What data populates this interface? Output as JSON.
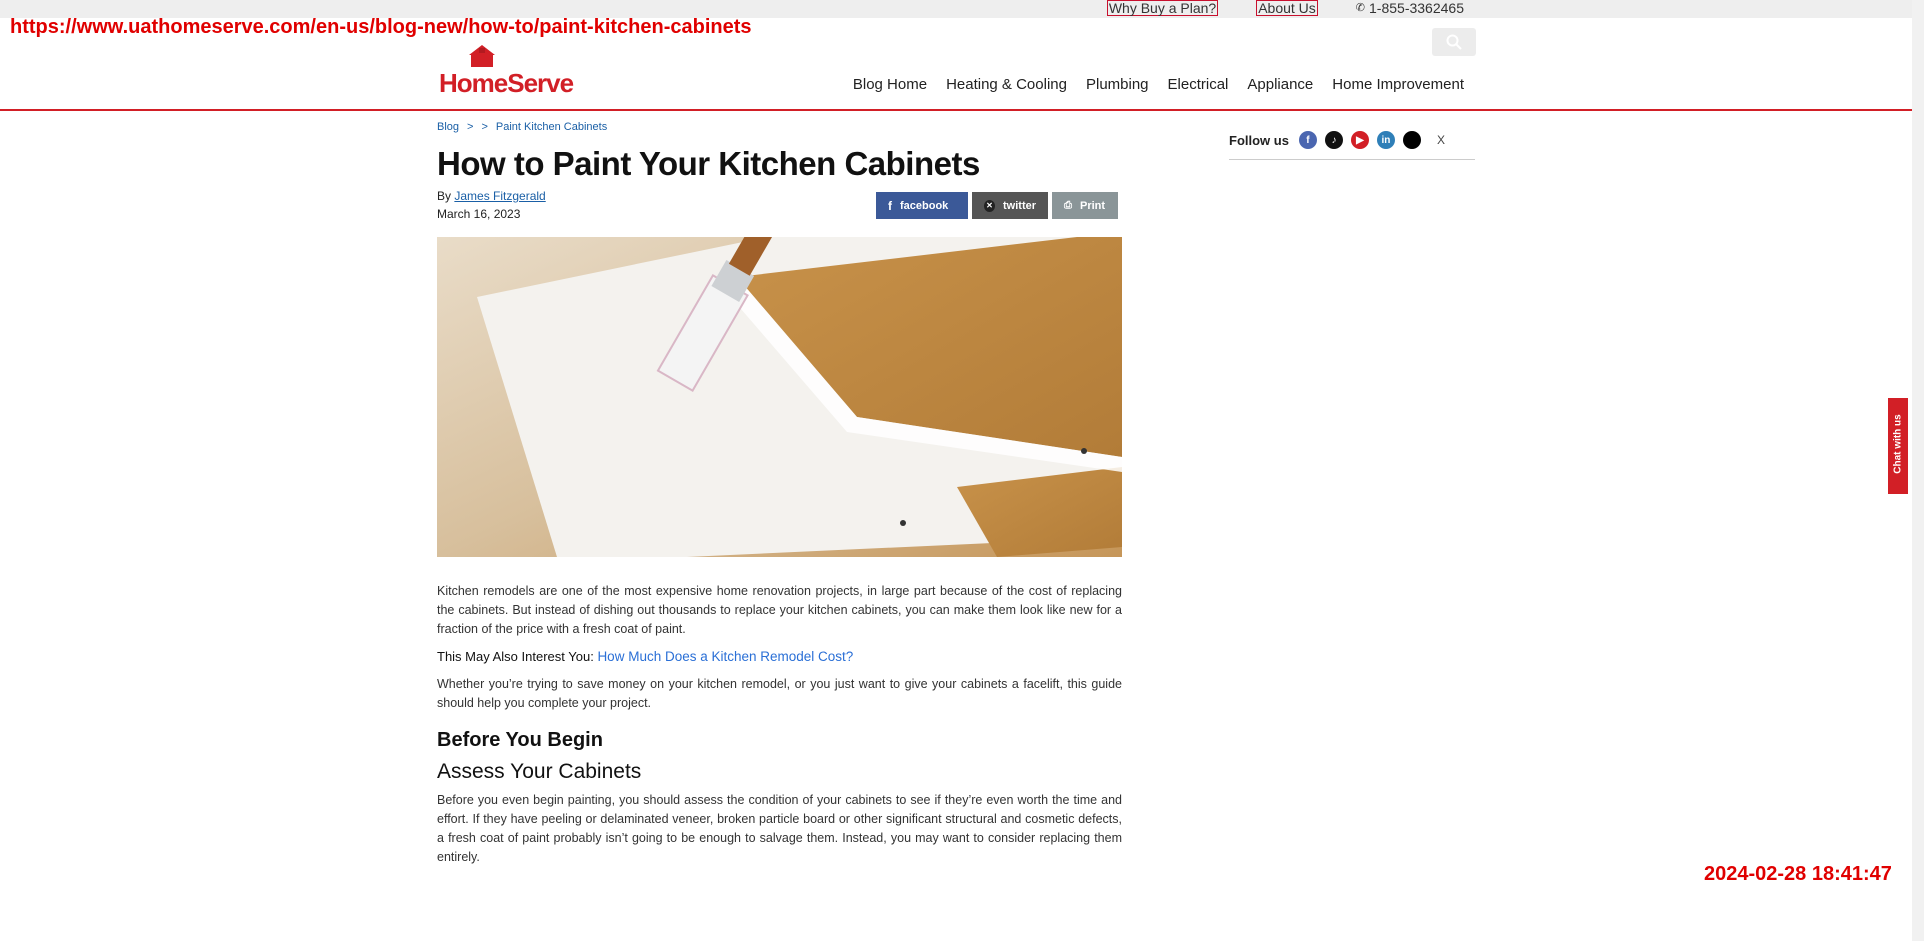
{
  "overlay": {
    "url": "https://www.uathomeserve.com/en-us/blog-new/how-to/paint-kitchen-cabinets",
    "timestamp": "2024-02-28 18:41:47"
  },
  "utility": {
    "why_buy": "Why Buy a Plan?",
    "about": "About Us",
    "phone": "1-855-3362465"
  },
  "header": {
    "logo_text": "HomeServe",
    "nav": [
      "Blog Home",
      "Heating & Cooling",
      "Plumbing",
      "Electrical",
      "Appliance",
      "Home Improvement"
    ]
  },
  "breadcrumb": {
    "blog": "Blog",
    "sep1": ">",
    "sep2": ">",
    "current": "Paint Kitchen Cabinets"
  },
  "article": {
    "title": "How to Paint Your Kitchen Cabinets",
    "by": "By",
    "author": "James Fitzgerald",
    "date": "March 16, 2023",
    "share": {
      "facebook": "facebook",
      "twitter": "twitter",
      "print": "Print"
    },
    "intro": "Kitchen remodels are one of the most expensive home renovation projects, in large part because of the cost of replacing the cabinets. But instead of dishing out thousands to replace your kitchen cabinets, you can make them look like new for a fraction of the price with a fresh coat of paint.",
    "interest_label": "This May Also Interest You:",
    "interest_link": "How Much Does a Kitchen Remodel Cost?",
    "para2": "Whether you’re trying to save money on your kitchen remodel, or you just want to give your cabinets a facelift, this guide should help you complete your project.",
    "h2": "Before You Begin",
    "h3": "Assess Your Cabinets",
    "para3": "Before you even begin painting, you should assess the condition of your cabinets to see if they’re even worth the time and effort. If they have peeling or delaminated veneer, broken particle board or other significant structural and cosmetic defects, a fresh coat of paint probably isn’t going to be enough to salvage them. Instead, you may want to consider replacing them entirely."
  },
  "sidebar": {
    "follow_label": "Follow us",
    "x_label": "X"
  },
  "chat": {
    "label": "Chat with us"
  }
}
